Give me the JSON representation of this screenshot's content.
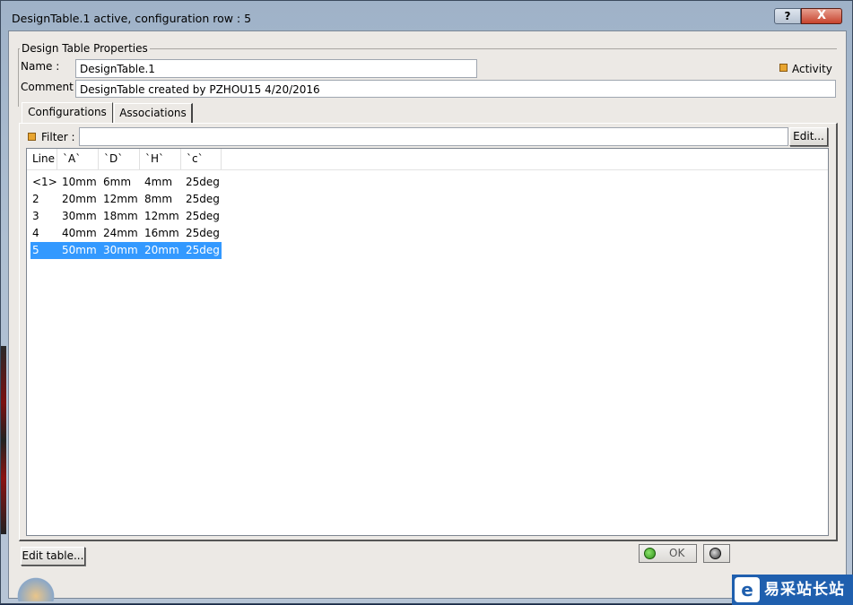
{
  "window": {
    "title": "DesignTable.1 active, configuration row : 5",
    "help_label": "?",
    "close_label": "X"
  },
  "properties": {
    "legend": "Design Table Properties",
    "name_label": "Name :",
    "name_value": "DesignTable.1",
    "comment_label": "Comment :",
    "comment_value": "DesignTable created by PZHOU15 4/20/2016",
    "activity_label": "Activity"
  },
  "tabs": [
    {
      "label": "Configurations",
      "active": true
    },
    {
      "label": "Associations",
      "active": false
    }
  ],
  "filter": {
    "label": "Filter :",
    "value": "",
    "edit_label": "Edit..."
  },
  "table": {
    "columns": [
      "Line",
      "`A`",
      "`D`",
      "`H`",
      "`c`"
    ],
    "rows": [
      {
        "line": "<1>",
        "a": "10mm",
        "d": "6mm",
        "h": "4mm",
        "c": "25deg",
        "selected": false
      },
      {
        "line": "2",
        "a": "20mm",
        "d": "12mm",
        "h": "8mm",
        "c": "25deg",
        "selected": false
      },
      {
        "line": "3",
        "a": "30mm",
        "d": "18mm",
        "h": "12mm",
        "c": "25deg",
        "selected": false
      },
      {
        "line": "4",
        "a": "40mm",
        "d": "24mm",
        "h": "16mm",
        "c": "25deg",
        "selected": false
      },
      {
        "line": "5",
        "a": "50mm",
        "d": "30mm",
        "h": "20mm",
        "c": "25deg",
        "selected": true
      }
    ]
  },
  "footer": {
    "edit_table_label": "Edit table...",
    "ok_label": "OK"
  },
  "watermark": {
    "text": "易采站长站",
    "icon": "e"
  },
  "colors": {
    "selection": "#3399ff",
    "activity_led": "#e8a530",
    "close_button": "#c7432e"
  }
}
